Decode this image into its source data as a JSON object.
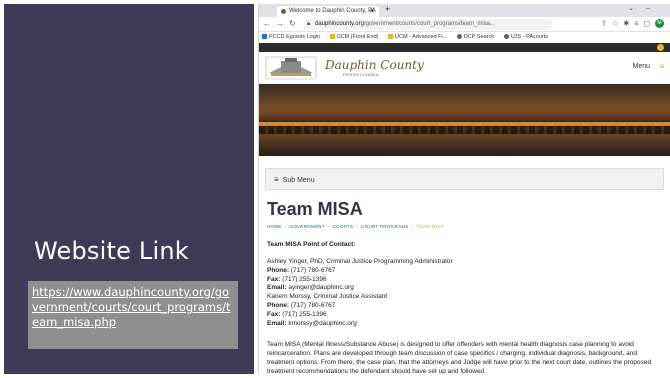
{
  "slide": {
    "title": "Website Link",
    "link": "https://www.dauphincounty.org/government/courts/court_programs/team_misa.php"
  },
  "browser": {
    "tab_title": "Welcome to Dauphin County, PA",
    "url_domain": "dauphincounty.org",
    "url_path": "/government/courts/court_programs/team_misa...",
    "bookmarks": [
      {
        "label": "PCCD Egrants Login",
        "color": "#1a73e8"
      },
      {
        "label": "UCM (Front End)",
        "color": "#f4b400"
      },
      {
        "label": "UCM - Advanced Fi...",
        "color": "#f4b400"
      },
      {
        "label": "DCP Search",
        "color": "#5f6368"
      },
      {
        "label": "UJS - PAcourts",
        "color": "#5f6368"
      }
    ],
    "profile_initial": "M"
  },
  "site": {
    "name": "Dauphin County",
    "subtitle": "PENNSYLVANIA",
    "menu_label": "Menu",
    "submenu_label": "Sub Menu",
    "page_title": "Team MISA",
    "breadcrumb": {
      "home": "HOME",
      "government": "GOVERNMENT",
      "courts": "COURTS",
      "court_programs": "COURT PROGRAMS",
      "current": "TEAM MISA"
    },
    "poc_heading": "Team MISA Point of Contact:",
    "contact1": {
      "name": "Ashley Yinger, PhD, Criminal Justice Programming Administrator",
      "phone_label": "Phone:",
      "phone": "(717) 780-6767",
      "fax_label": "Fax:",
      "fax": "(717) 255-1396",
      "email_label": "Email:",
      "email": "ayinger@dauphinc.org"
    },
    "contact2": {
      "name": "Kariem Morssy, Criminal Justice Assistant",
      "phone_label": "Phone:",
      "phone": "(717) 780-6767",
      "fax_label": "Fax:",
      "fax": "(717) 255-1396",
      "email_label": "Email:",
      "email": "kmorssy@dauphinc.org"
    },
    "description": "Team MISA (Mental Illness/Substance Abuse) is designed to offer offenders with mental health diagnosis case planning to avoid reincarceration. Plans are developed through team discussion of case specifics / charging, individual diagnosis, background, and treatment options. From there, the case plan, that the attorneys and Judge will have prior to the next court date, outlines the proposed treatment recommendations the defendant should have set up and followed."
  },
  "colors": {
    "panel": "#3f3a56",
    "link_box": "#8f8f8f",
    "site_title": "#3b2f4f",
    "breadcrumb_current": "#d8a04a"
  }
}
